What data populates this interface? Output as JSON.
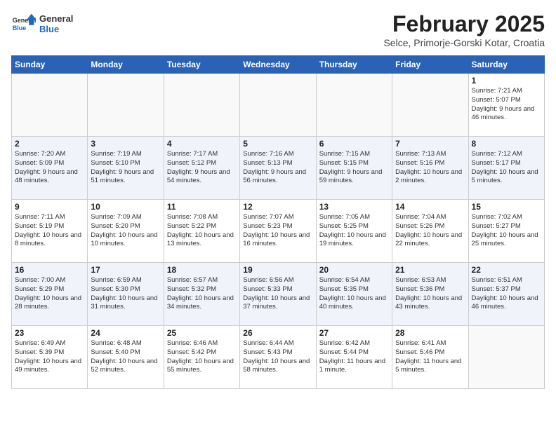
{
  "header": {
    "logo_general": "General",
    "logo_blue": "Blue",
    "month_year": "February 2025",
    "location": "Selce, Primorje-Gorski Kotar, Croatia"
  },
  "columns": [
    "Sunday",
    "Monday",
    "Tuesday",
    "Wednesday",
    "Thursday",
    "Friday",
    "Saturday"
  ],
  "weeks": [
    [
      {
        "day": "",
        "info": ""
      },
      {
        "day": "",
        "info": ""
      },
      {
        "day": "",
        "info": ""
      },
      {
        "day": "",
        "info": ""
      },
      {
        "day": "",
        "info": ""
      },
      {
        "day": "",
        "info": ""
      },
      {
        "day": "1",
        "info": "Sunrise: 7:21 AM\nSunset: 5:07 PM\nDaylight: 9 hours and 46 minutes."
      }
    ],
    [
      {
        "day": "2",
        "info": "Sunrise: 7:20 AM\nSunset: 5:09 PM\nDaylight: 9 hours and 48 minutes."
      },
      {
        "day": "3",
        "info": "Sunrise: 7:19 AM\nSunset: 5:10 PM\nDaylight: 9 hours and 51 minutes."
      },
      {
        "day": "4",
        "info": "Sunrise: 7:17 AM\nSunset: 5:12 PM\nDaylight: 9 hours and 54 minutes."
      },
      {
        "day": "5",
        "info": "Sunrise: 7:16 AM\nSunset: 5:13 PM\nDaylight: 9 hours and 56 minutes."
      },
      {
        "day": "6",
        "info": "Sunrise: 7:15 AM\nSunset: 5:15 PM\nDaylight: 9 hours and 59 minutes."
      },
      {
        "day": "7",
        "info": "Sunrise: 7:13 AM\nSunset: 5:16 PM\nDaylight: 10 hours and 2 minutes."
      },
      {
        "day": "8",
        "info": "Sunrise: 7:12 AM\nSunset: 5:17 PM\nDaylight: 10 hours and 5 minutes."
      }
    ],
    [
      {
        "day": "9",
        "info": "Sunrise: 7:11 AM\nSunset: 5:19 PM\nDaylight: 10 hours and 8 minutes."
      },
      {
        "day": "10",
        "info": "Sunrise: 7:09 AM\nSunset: 5:20 PM\nDaylight: 10 hours and 10 minutes."
      },
      {
        "day": "11",
        "info": "Sunrise: 7:08 AM\nSunset: 5:22 PM\nDaylight: 10 hours and 13 minutes."
      },
      {
        "day": "12",
        "info": "Sunrise: 7:07 AM\nSunset: 5:23 PM\nDaylight: 10 hours and 16 minutes."
      },
      {
        "day": "13",
        "info": "Sunrise: 7:05 AM\nSunset: 5:25 PM\nDaylight: 10 hours and 19 minutes."
      },
      {
        "day": "14",
        "info": "Sunrise: 7:04 AM\nSunset: 5:26 PM\nDaylight: 10 hours and 22 minutes."
      },
      {
        "day": "15",
        "info": "Sunrise: 7:02 AM\nSunset: 5:27 PM\nDaylight: 10 hours and 25 minutes."
      }
    ],
    [
      {
        "day": "16",
        "info": "Sunrise: 7:00 AM\nSunset: 5:29 PM\nDaylight: 10 hours and 28 minutes."
      },
      {
        "day": "17",
        "info": "Sunrise: 6:59 AM\nSunset: 5:30 PM\nDaylight: 10 hours and 31 minutes."
      },
      {
        "day": "18",
        "info": "Sunrise: 6:57 AM\nSunset: 5:32 PM\nDaylight: 10 hours and 34 minutes."
      },
      {
        "day": "19",
        "info": "Sunrise: 6:56 AM\nSunset: 5:33 PM\nDaylight: 10 hours and 37 minutes."
      },
      {
        "day": "20",
        "info": "Sunrise: 6:54 AM\nSunset: 5:35 PM\nDaylight: 10 hours and 40 minutes."
      },
      {
        "day": "21",
        "info": "Sunrise: 6:53 AM\nSunset: 5:36 PM\nDaylight: 10 hours and 43 minutes."
      },
      {
        "day": "22",
        "info": "Sunrise: 6:51 AM\nSunset: 5:37 PM\nDaylight: 10 hours and 46 minutes."
      }
    ],
    [
      {
        "day": "23",
        "info": "Sunrise: 6:49 AM\nSunset: 5:39 PM\nDaylight: 10 hours and 49 minutes."
      },
      {
        "day": "24",
        "info": "Sunrise: 6:48 AM\nSunset: 5:40 PM\nDaylight: 10 hours and 52 minutes."
      },
      {
        "day": "25",
        "info": "Sunrise: 6:46 AM\nSunset: 5:42 PM\nDaylight: 10 hours and 55 minutes."
      },
      {
        "day": "26",
        "info": "Sunrise: 6:44 AM\nSunset: 5:43 PM\nDaylight: 10 hours and 58 minutes."
      },
      {
        "day": "27",
        "info": "Sunrise: 6:42 AM\nSunset: 5:44 PM\nDaylight: 11 hours and 1 minute."
      },
      {
        "day": "28",
        "info": "Sunrise: 6:41 AM\nSunset: 5:46 PM\nDaylight: 11 hours and 5 minutes."
      },
      {
        "day": "",
        "info": ""
      }
    ]
  ]
}
